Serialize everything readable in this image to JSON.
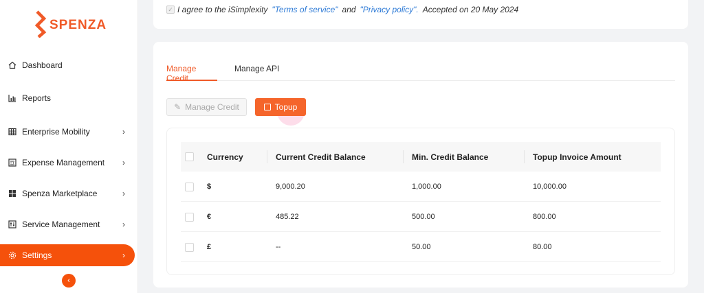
{
  "brand": {
    "name": "SPENZA",
    "color": "#f05a28"
  },
  "sidebar": {
    "items": [
      {
        "label": "Dashboard",
        "icon": "home-icon",
        "has_submenu": false
      },
      {
        "label": "Reports",
        "icon": "bar-chart-icon",
        "has_submenu": false
      },
      {
        "label": "Enterprise Mobility",
        "icon": "grid-table-icon",
        "has_submenu": true
      },
      {
        "label": "Expense Management",
        "icon": "ledger-icon",
        "has_submenu": true
      },
      {
        "label": "Spenza Marketplace",
        "icon": "tiles-icon",
        "has_submenu": true
      },
      {
        "label": "Service Management",
        "icon": "sliders-icon",
        "has_submenu": true
      },
      {
        "label": "Settings",
        "icon": "gear-icon",
        "has_submenu": true,
        "active": true
      }
    ],
    "collapse_icon": "chevron-left-icon",
    "active_color": "#f5510b"
  },
  "agreement": {
    "prefix": "I agree to the iSimplexity",
    "terms_link": "\"Terms of service\"",
    "and": "and",
    "privacy_link": "\"Privacy policy\".",
    "accepted": "Accepted on 20 May 2024",
    "link_color": "#2d7ad6"
  },
  "tabs": [
    {
      "label": "Manage Credit",
      "active": true
    },
    {
      "label": "Manage API",
      "active": false
    }
  ],
  "actions": {
    "manage_credit_label": "Manage Credit",
    "topup_label": "Topup"
  },
  "table": {
    "columns": [
      "Currency",
      "Current Credit Balance",
      "Min. Credit Balance",
      "Topup Invoice Amount"
    ],
    "rows": [
      {
        "currency": "$",
        "current": "9,000.20",
        "min": "1,000.00",
        "topup": "10,000.00"
      },
      {
        "currency": "€",
        "current": "485.22",
        "min": "500.00",
        "topup": "800.00"
      },
      {
        "currency": "£",
        "current": "--",
        "min": "50.00",
        "topup": "80.00"
      }
    ]
  }
}
